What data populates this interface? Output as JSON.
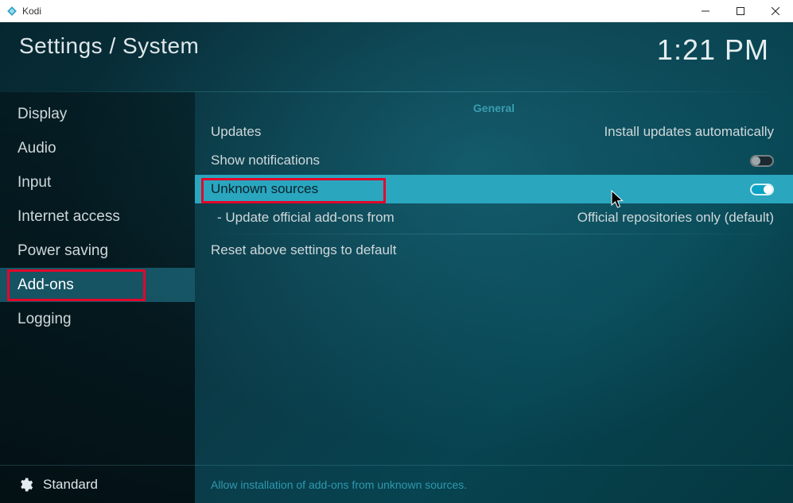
{
  "window": {
    "title": "Kodi"
  },
  "header": {
    "title": "Settings / System",
    "clock": "1:21 PM"
  },
  "sidebar": {
    "items": [
      {
        "label": "Display"
      },
      {
        "label": "Audio"
      },
      {
        "label": "Input"
      },
      {
        "label": "Internet access"
      },
      {
        "label": "Power saving"
      },
      {
        "label": "Add-ons",
        "active": true
      },
      {
        "label": "Logging"
      }
    ],
    "footer": {
      "label": "Standard",
      "icon": "gear-icon"
    }
  },
  "content": {
    "section": "General",
    "rows": [
      {
        "label": "Updates",
        "value": "Install updates automatically",
        "type": "select"
      },
      {
        "label": "Show notifications",
        "type": "toggle",
        "on": false
      },
      {
        "label": "Unknown sources",
        "type": "toggle",
        "on": true,
        "highlight": true
      },
      {
        "label": "- Update official add-ons from",
        "value": "Official repositories only (default)",
        "type": "select",
        "indent": true
      },
      {
        "label": "Reset above settings to default",
        "type": "action"
      }
    ],
    "hint": "Allow installation of add-ons from unknown sources."
  }
}
